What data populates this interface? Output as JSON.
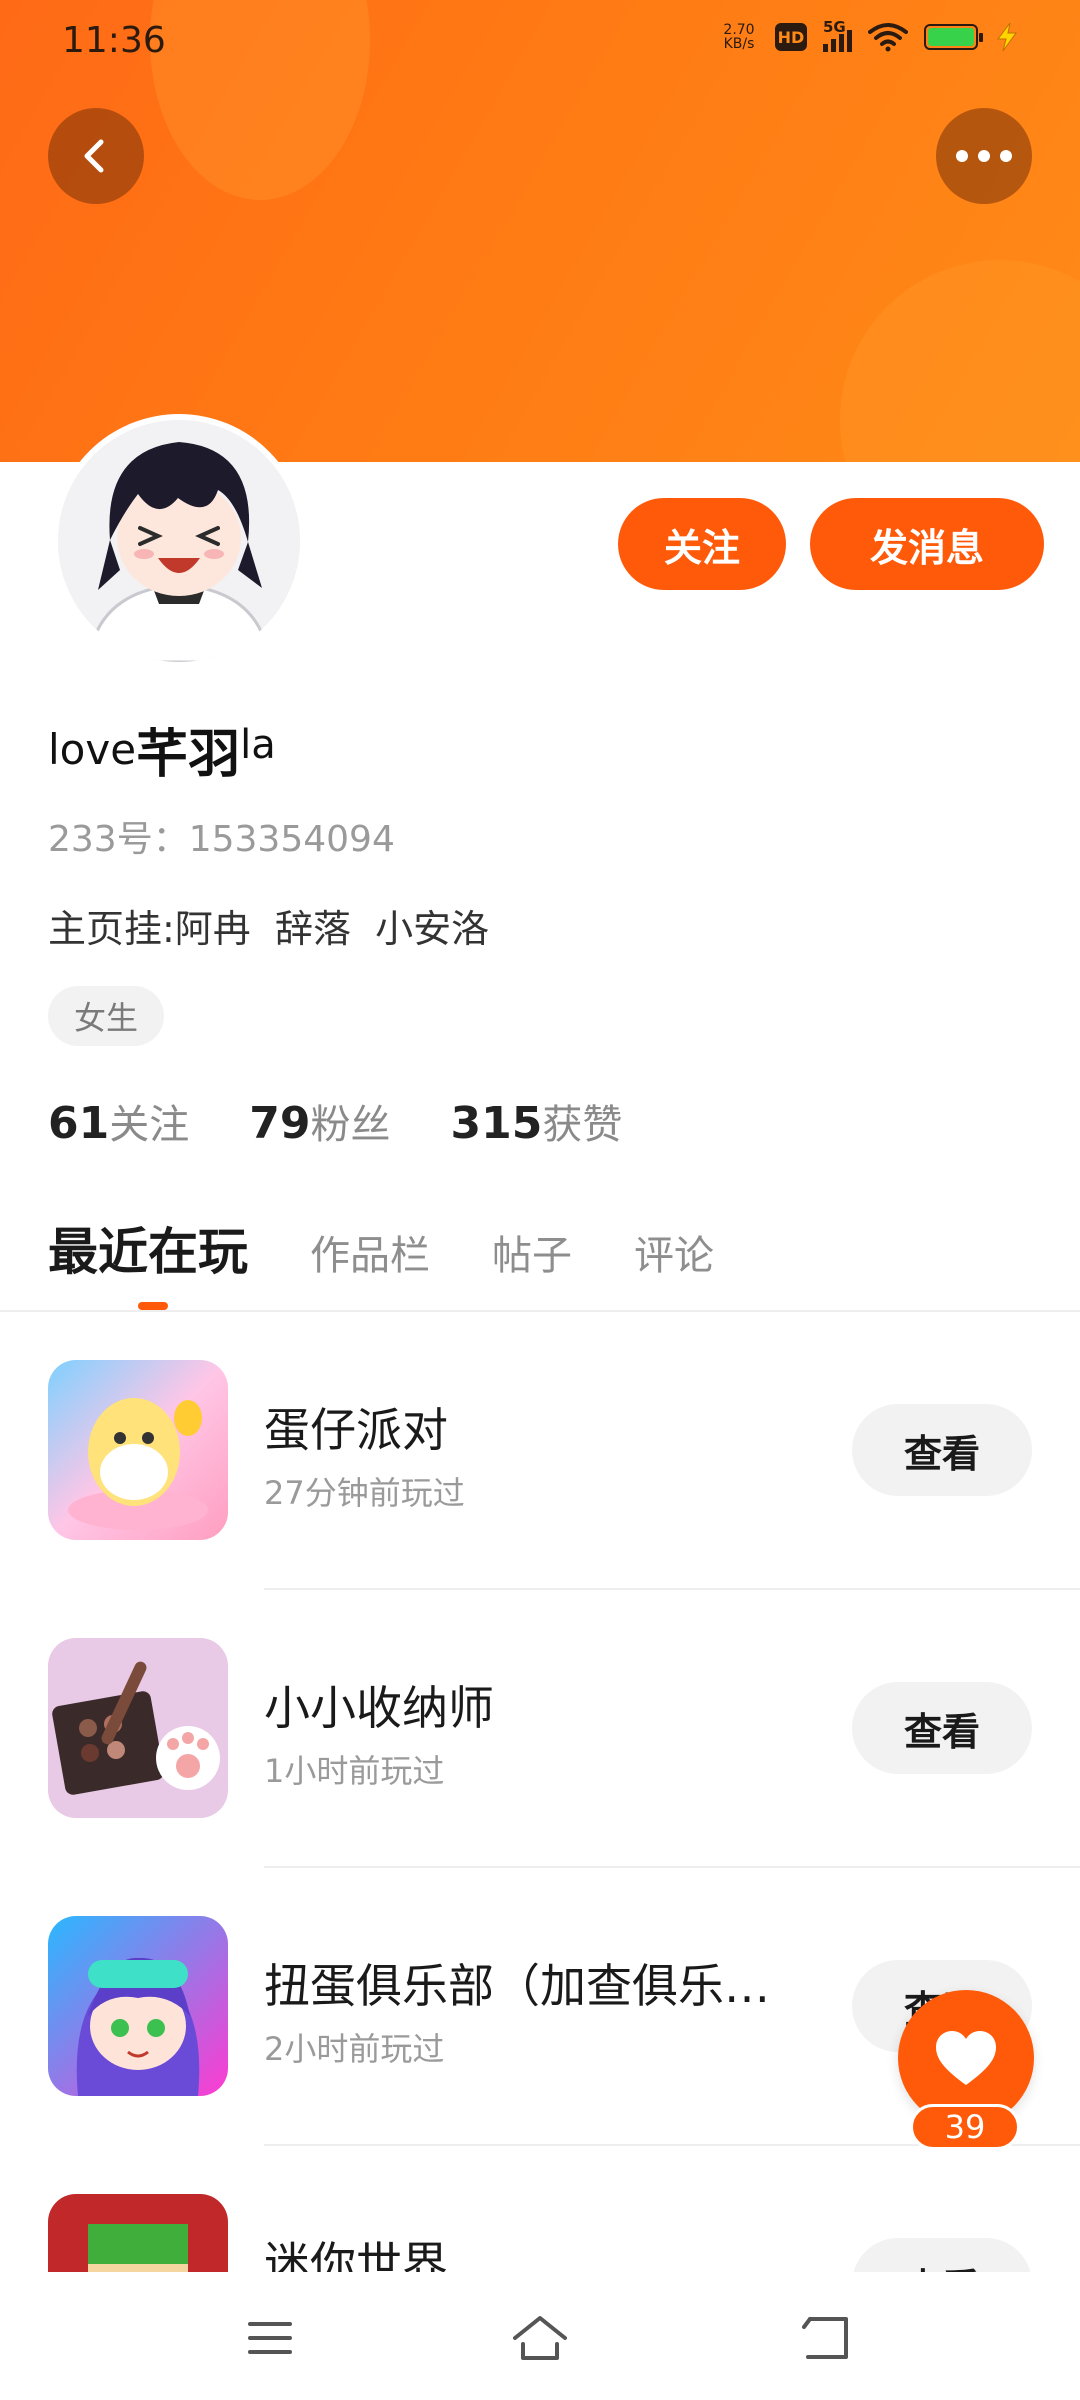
{
  "status_bar": {
    "time": "11:36",
    "net_speed_value": "2.70",
    "net_speed_unit": "KB/s",
    "hd_label": "HD",
    "network_label": "5G",
    "battery_color": "#37d24a"
  },
  "header": {
    "back_icon": "chevron-left-icon",
    "more_icon": "more-dots-icon",
    "banner_color": "#ff7a14"
  },
  "profile": {
    "username_prefix": "love",
    "username_main": "芊羽",
    "username_suffix": "la",
    "user_id": "233号：153354094",
    "bio": "主页挂:阿冉  辞落  小安洛",
    "gender": "女生",
    "follow_label": "关注",
    "message_label": "发消息",
    "accent_color": "#ff5a0a"
  },
  "stats": {
    "following_count": "61",
    "following_label": "关注",
    "followers_count": "79",
    "followers_label": "粉丝",
    "likes_count": "315",
    "likes_label": "获赞"
  },
  "tabs": [
    {
      "label": "最近在玩",
      "active": true
    },
    {
      "label": "作品栏",
      "active": false
    },
    {
      "label": "帖子",
      "active": false
    },
    {
      "label": "评论",
      "active": false
    }
  ],
  "games": [
    {
      "name": "蛋仔派对",
      "time": "27分钟前玩过",
      "button": "查看"
    },
    {
      "name": "小小收纳师",
      "time": "1小时前玩过",
      "button": "查看"
    },
    {
      "name": "扭蛋俱乐部（加查俱乐…",
      "time": "2小时前玩过",
      "button": "查看"
    },
    {
      "name": "迷你世界",
      "time": "",
      "button": "查看"
    }
  ],
  "like_fab": {
    "icon": "heart-icon",
    "count": "39"
  },
  "bottom_nav": {
    "menu_icon": "menu-icon",
    "home_icon": "home-icon",
    "back_icon": "back-icon"
  }
}
